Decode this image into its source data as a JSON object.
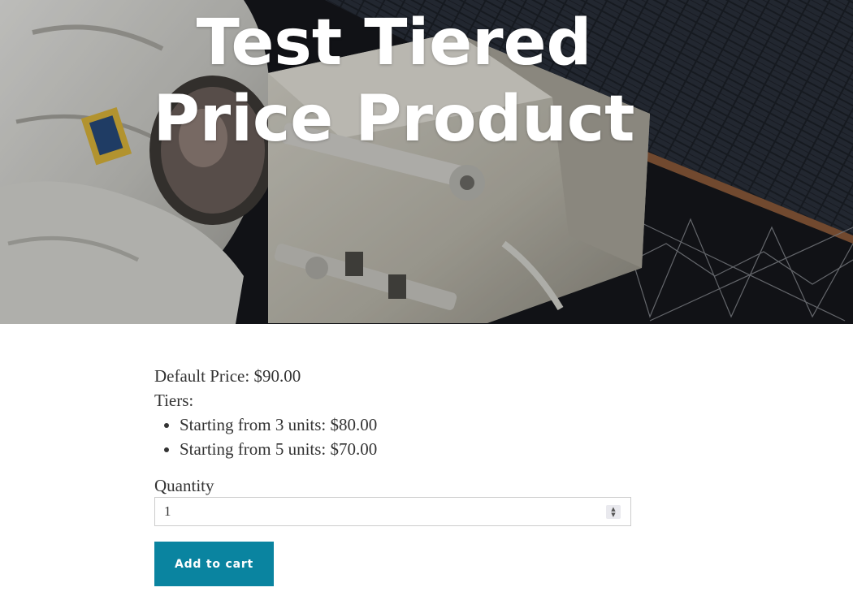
{
  "hero": {
    "title": "Test Tiered\nPrice Product",
    "image_semantic": "astronaut-spacewalk-photo",
    "overlay_color": "#000000"
  },
  "product": {
    "default_price_text": "Default Price: $90.00",
    "tiers_label": "Tiers:",
    "tiers": [
      {
        "label": "Starting from 3 units:",
        "price": "$80.00"
      },
      {
        "label": "Starting from 5 units:",
        "price": "$70.00"
      }
    ]
  },
  "form": {
    "quantity_label": "Quantity",
    "quantity_value": "1",
    "add_to_cart_label": "Add to cart"
  },
  "colors": {
    "button_bg": "#0a84a0",
    "button_text": "#ffffff",
    "body_text": "#333333"
  }
}
